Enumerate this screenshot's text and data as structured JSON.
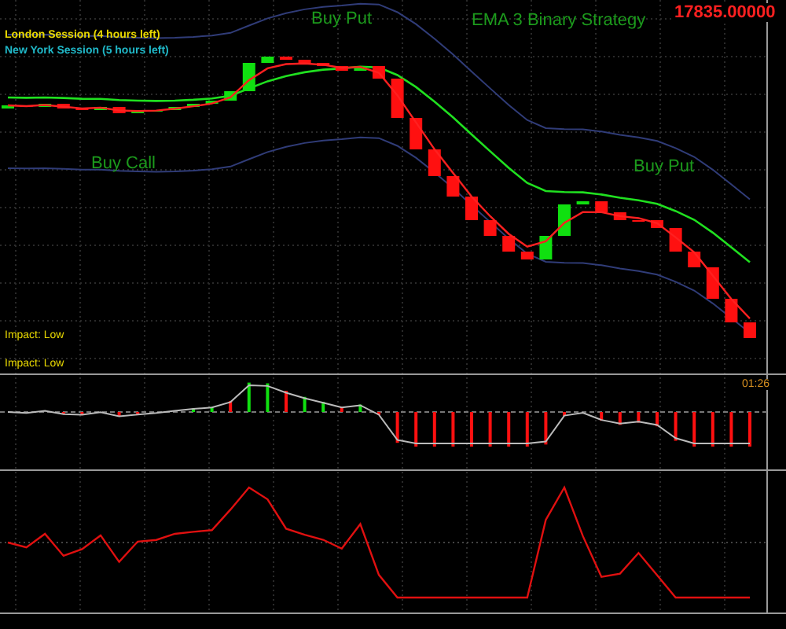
{
  "chart": {
    "title": "EMA 3 Binary Strategy",
    "price": "17835.00000",
    "timer": "01:26"
  },
  "sessions": [
    {
      "label": "London Session (4 hours left)",
      "color": "#e8d800"
    },
    {
      "label": "New York Session (5 hours left)",
      "color": "#20b8c8"
    }
  ],
  "signals": [
    {
      "kind": "put",
      "label": "Buy Put"
    },
    {
      "kind": "call",
      "label": "Buy Call"
    },
    {
      "kind": "put",
      "label": "Buy Put"
    }
  ],
  "news": [
    {
      "label": "Impact: Low"
    },
    {
      "label": "Impact: Low"
    }
  ]
}
